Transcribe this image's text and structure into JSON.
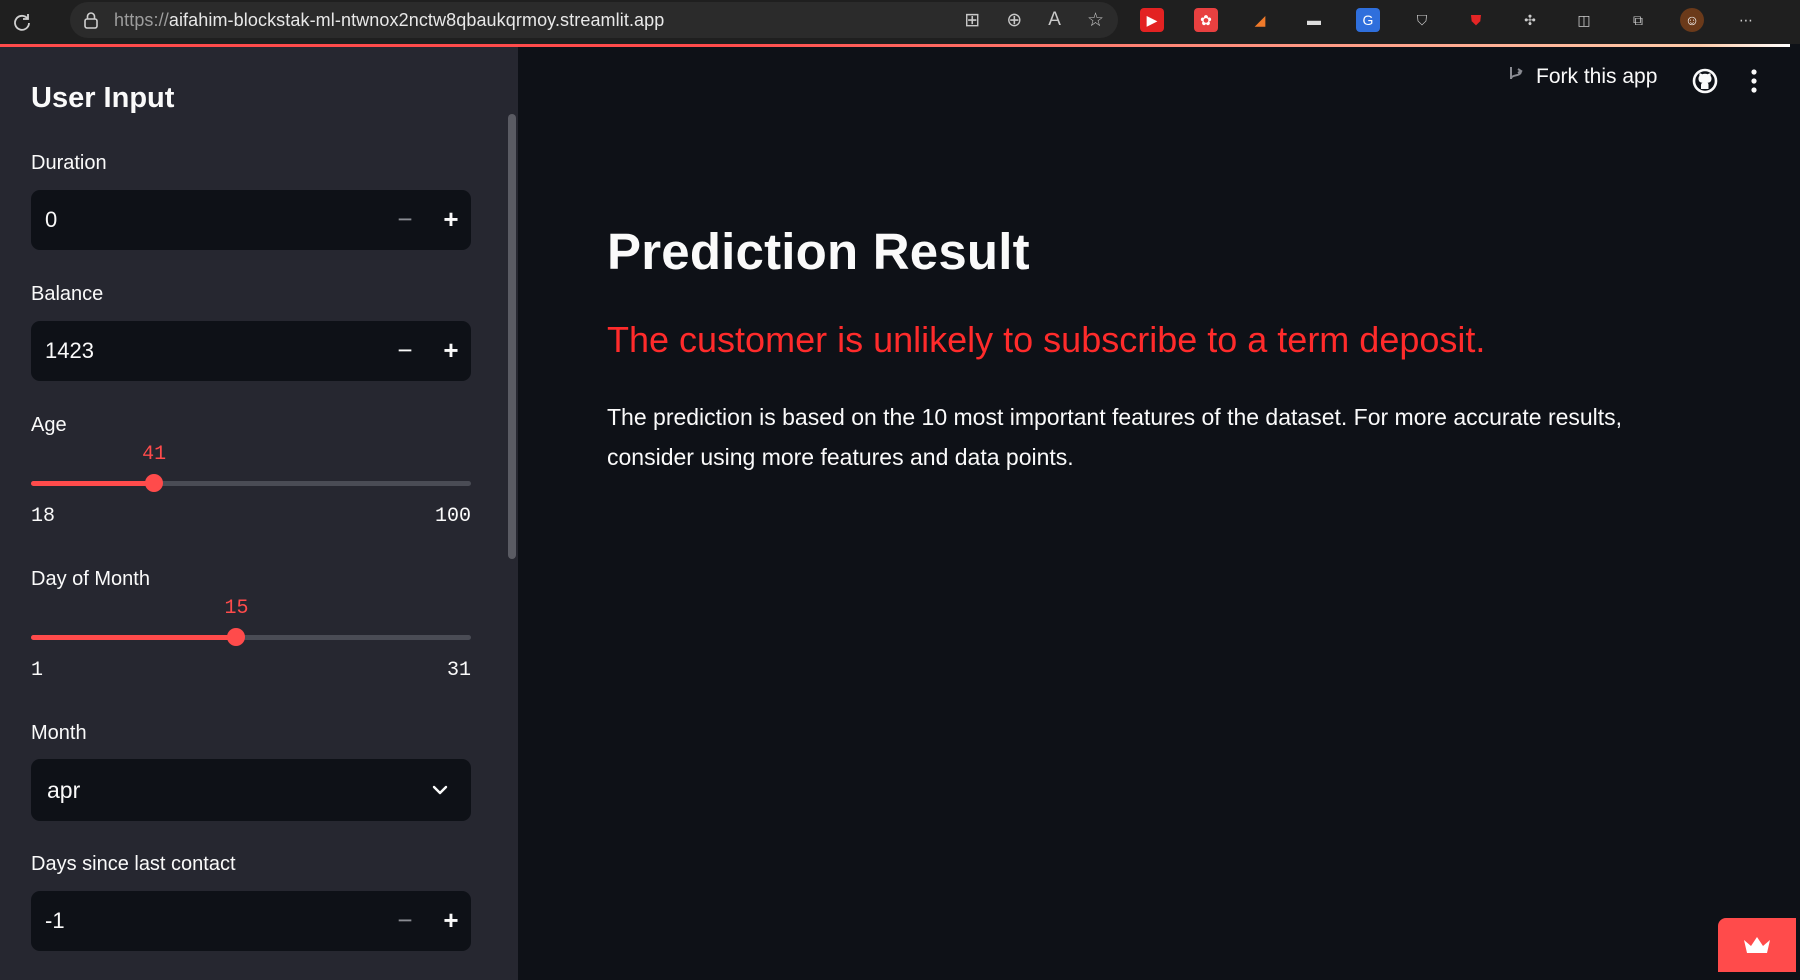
{
  "browser": {
    "url_prefix": "https://",
    "url_host": "aifahim-blockstak-ml-ntwnox2nctw8qbaukqrmoy.streamlit.app"
  },
  "toolbar": {
    "fork_label": "Fork this app"
  },
  "sidebar": {
    "title": "User Input",
    "duration": {
      "label": "Duration",
      "value": "0"
    },
    "balance": {
      "label": "Balance",
      "value": "1423"
    },
    "age": {
      "label": "Age",
      "value": "41",
      "min": "18",
      "max": "100",
      "fraction": 0.28
    },
    "day": {
      "label": "Day of Month",
      "value": "15",
      "min": "1",
      "max": "31",
      "fraction": 0.467
    },
    "month": {
      "label": "Month",
      "value": "apr"
    },
    "pdays": {
      "label": "Days since last contact",
      "value": "-1"
    }
  },
  "main": {
    "title": "Prediction Result",
    "result": "The customer is unlikely to subscribe to a term deposit.",
    "note": "The prediction is based on the 10 most important features of the dataset. For more accurate results, consider using more features and data points."
  },
  "colors": {
    "accent": "#ff4b4b",
    "result_text": "#ff2b2b",
    "sidebar_bg": "#262730",
    "main_bg": "#0e1117"
  }
}
